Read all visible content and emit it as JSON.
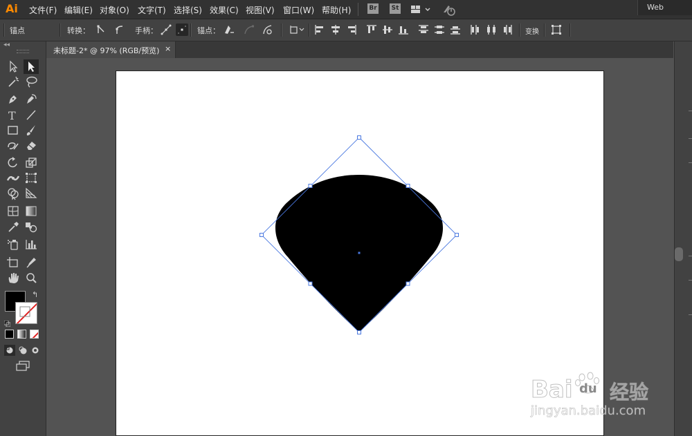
{
  "app": {
    "logo": "Ai",
    "workspace": "Web"
  },
  "menu": {
    "items": [
      "文件(F)",
      "编辑(E)",
      "对象(O)",
      "文字(T)",
      "选择(S)",
      "效果(C)",
      "视图(V)",
      "窗口(W)",
      "帮助(H)"
    ]
  },
  "badges": {
    "bridge": "Br",
    "stock": "St"
  },
  "control_bar": {
    "anchor_label": "锚点",
    "convert_label": "转换：",
    "handles_label": "手柄：",
    "anchors_label": "锚点：",
    "transform_label": "变换"
  },
  "document": {
    "tab_title": "未标题-2* @ 97% (RGB/预览)",
    "close_glyph": "×"
  },
  "tools": {
    "items": [
      "selection-tool",
      "direct-selection-tool",
      "magic-wand-tool",
      "lasso-tool",
      "pen-tool",
      "curvature-tool",
      "type-tool",
      "line-tool",
      "rectangle-tool",
      "paintbrush-tool",
      "shaper-tool",
      "eraser-tool",
      "rotate-tool",
      "scale-tool",
      "width-tool",
      "free-transform-tool",
      "shape-builder-tool",
      "perspective-grid-tool",
      "mesh-tool",
      "gradient-tool",
      "eyedropper-tool",
      "blend-tool",
      "symbol-sprayer-tool",
      "column-graph-tool",
      "artboard-tool",
      "slice-tool",
      "hand-tool",
      "zoom-tool"
    ],
    "selected": "direct-selection-tool"
  },
  "colors": {
    "fill": "#000000",
    "stroke": "none",
    "selection": "#4a78e0",
    "accent": "#ff8a00"
  },
  "watermark": {
    "brand": "Bai",
    "brand2": "du",
    "suffix": "经验",
    "url": "jingyan.baidu.com"
  }
}
